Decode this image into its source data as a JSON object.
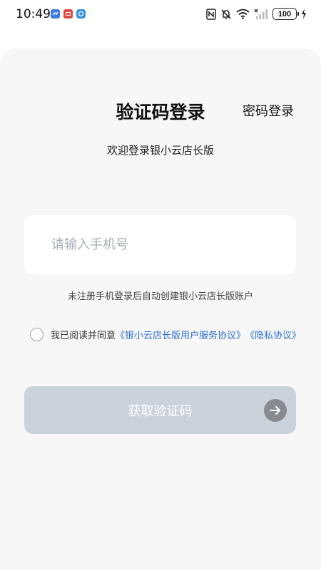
{
  "status_bar": {
    "time": "10:49",
    "battery": "100",
    "notification_icons": [
      "blue-app-icon",
      "red-app-icon",
      "blue-sync-icon"
    ],
    "system_icons": [
      "nfc-icon",
      "mute-icon",
      "wifi-icon",
      "signal-icon",
      "battery-icon",
      "charging-icon"
    ]
  },
  "header": {
    "title": "验证码登录",
    "password_login": "密码登录"
  },
  "welcome": "欢迎登录银小云店长版",
  "phone": {
    "placeholder": "请输入手机号",
    "value": ""
  },
  "hint": "未注册手机登录后自动创建银小云店长版账户",
  "agreement": {
    "prefix": "我已阅读并同意",
    "user_agreement": "《银小云店长版用户服务协议》",
    "privacy": "《隐私协议》",
    "checked": false
  },
  "get_code_button": {
    "label": "获取验证码"
  },
  "colors": {
    "link": "#2d6fd0",
    "button_disabled": "#ccd2db",
    "background": "#f7f7f8"
  }
}
